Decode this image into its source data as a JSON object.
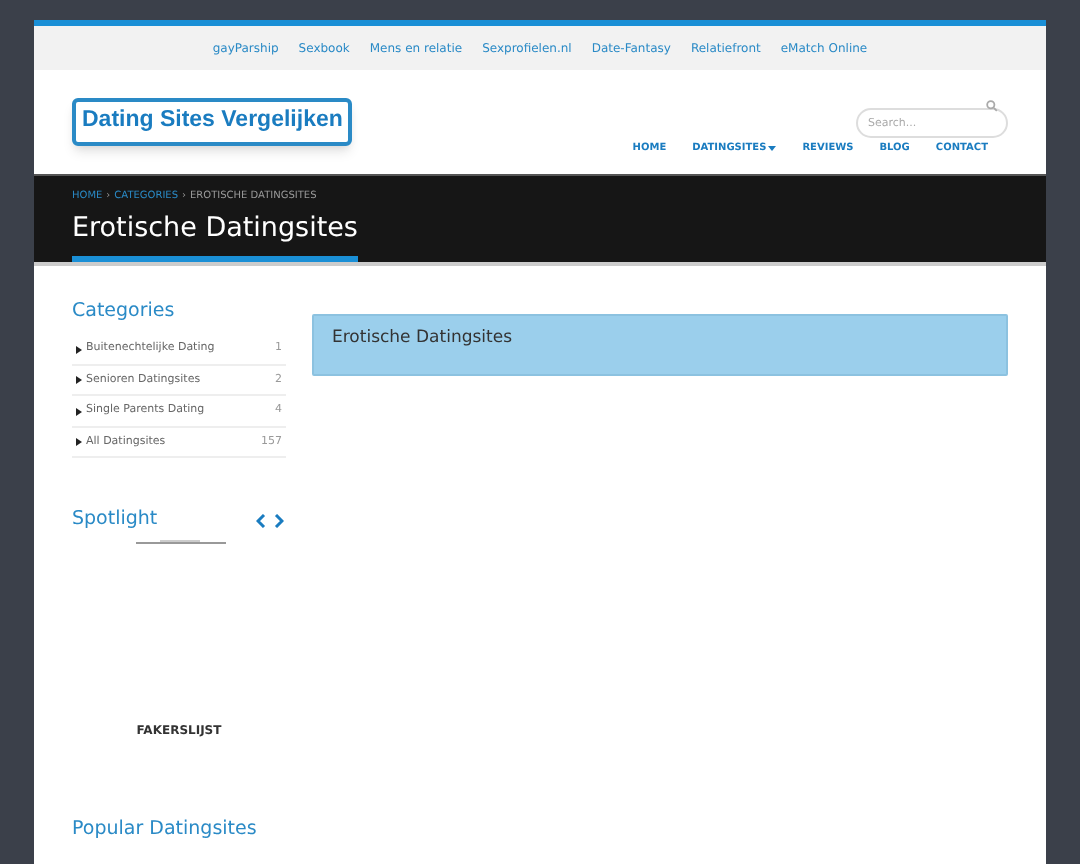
{
  "top_links": [
    "gayParship",
    "Sexbook",
    "Mens en relatie",
    "Sexprofielen.nl",
    "Date-Fantasy",
    "Relatiefront",
    "eMatch Online"
  ],
  "logo": "Dating Sites Vergelijken",
  "search": {
    "placeholder": "Search..."
  },
  "nav": [
    {
      "label": "HOME",
      "dropdown": false
    },
    {
      "label": "DATINGSITES",
      "dropdown": true
    },
    {
      "label": "REVIEWS",
      "dropdown": false
    },
    {
      "label": "BLOG",
      "dropdown": false
    },
    {
      "label": "CONTACT",
      "dropdown": false
    }
  ],
  "breadcrumb": [
    {
      "label": "HOME",
      "link": true
    },
    {
      "label": "›",
      "link": false
    },
    {
      "label": "CATEGORIES",
      "link": true
    },
    {
      "label": "›",
      "link": false
    },
    {
      "label": "EROTISCHE DATINGSITES",
      "link": false
    }
  ],
  "page_title": "Erotische Datingsites",
  "sidebar": {
    "categories_title": "Categories",
    "categories": [
      {
        "label": "Buitenechtelijke Dating",
        "count": "1"
      },
      {
        "label": "Senioren Datingsites",
        "count": "2"
      },
      {
        "label": "Single Parents Dating",
        "count": "4"
      },
      {
        "label": "All Datingsites",
        "count": "157"
      }
    ],
    "spotlight_title": "Spotlight",
    "spotlight_caption": "FAKERSLIJST",
    "popular_title": "Popular Datingsites"
  },
  "notice": "Erotische Datingsites"
}
